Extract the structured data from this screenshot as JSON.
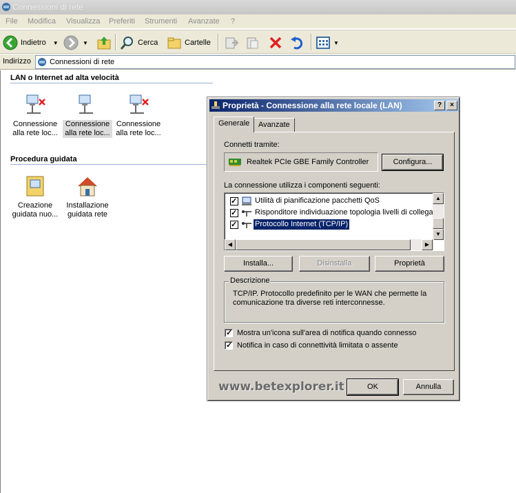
{
  "window": {
    "title": "Connessioni di rete"
  },
  "menu": [
    "File",
    "Modifica",
    "Visualizza",
    "Preferiti",
    "Strumenti",
    "Avanzate",
    "?"
  ],
  "toolbar": {
    "back_label": "Indietro",
    "search_label": "Cerca",
    "folders_label": "Cartelle"
  },
  "address": {
    "label": "Indirizzo",
    "value": "Connessioni di rete"
  },
  "sections": {
    "lan_title": "LAN o Internet ad alta velocità",
    "lan_items": [
      {
        "line1": "Connessione",
        "line2": "alla rete loc..."
      },
      {
        "line1": "Connessione",
        "line2": "alla rete loc..."
      },
      {
        "line1": "Connessione",
        "line2": "alla rete loc..."
      }
    ],
    "wizard_title": "Procedura guidata",
    "wizard_items": [
      {
        "line1": "Creazione",
        "line2": "guidata nuo..."
      },
      {
        "line1": "Installazione",
        "line2": "guidata rete"
      }
    ]
  },
  "dialog": {
    "title": "Proprietà - Connessione alla rete locale (LAN)",
    "help_btn": "?",
    "close_btn": "×",
    "tabs": [
      "Generale",
      "Avanzate"
    ],
    "connect_via_label": "Connetti tramite:",
    "adapter_name": "Realtek PCIe GBE Family Controller",
    "configure_btn": "Configura...",
    "components_label": "La connessione utilizza i componenti seguenti:",
    "components": [
      {
        "label": "Utilità di pianificazione pacchetti QoS",
        "checked": true,
        "selected": false
      },
      {
        "label": "Risponditore individuazione topologia livelli di collegame",
        "checked": true,
        "selected": false
      },
      {
        "label": "Protocollo Internet (TCP/IP)",
        "checked": true,
        "selected": true
      }
    ],
    "install_btn": "Installa...",
    "uninstall_btn": "Disinstalla",
    "properties_btn": "Proprietà",
    "description_legend": "Descrizione",
    "description_text": "TCP/IP. Protocollo predefinito per le WAN che permette la comunicazione tra diverse reti interconnesse.",
    "show_icon_label": "Mostra un'icona sull'area di notifica quando connesso",
    "notify_label": "Notifica in caso di connettività limitata o assente",
    "watermark": "www.betexplorer.it",
    "ok_btn": "OK",
    "cancel_btn": "Annulla"
  },
  "colors": {
    "dialog_bg": "#d4d0c8",
    "title_start": "#0a246a",
    "title_end": "#a6caf0",
    "selection": "#0a246a"
  }
}
